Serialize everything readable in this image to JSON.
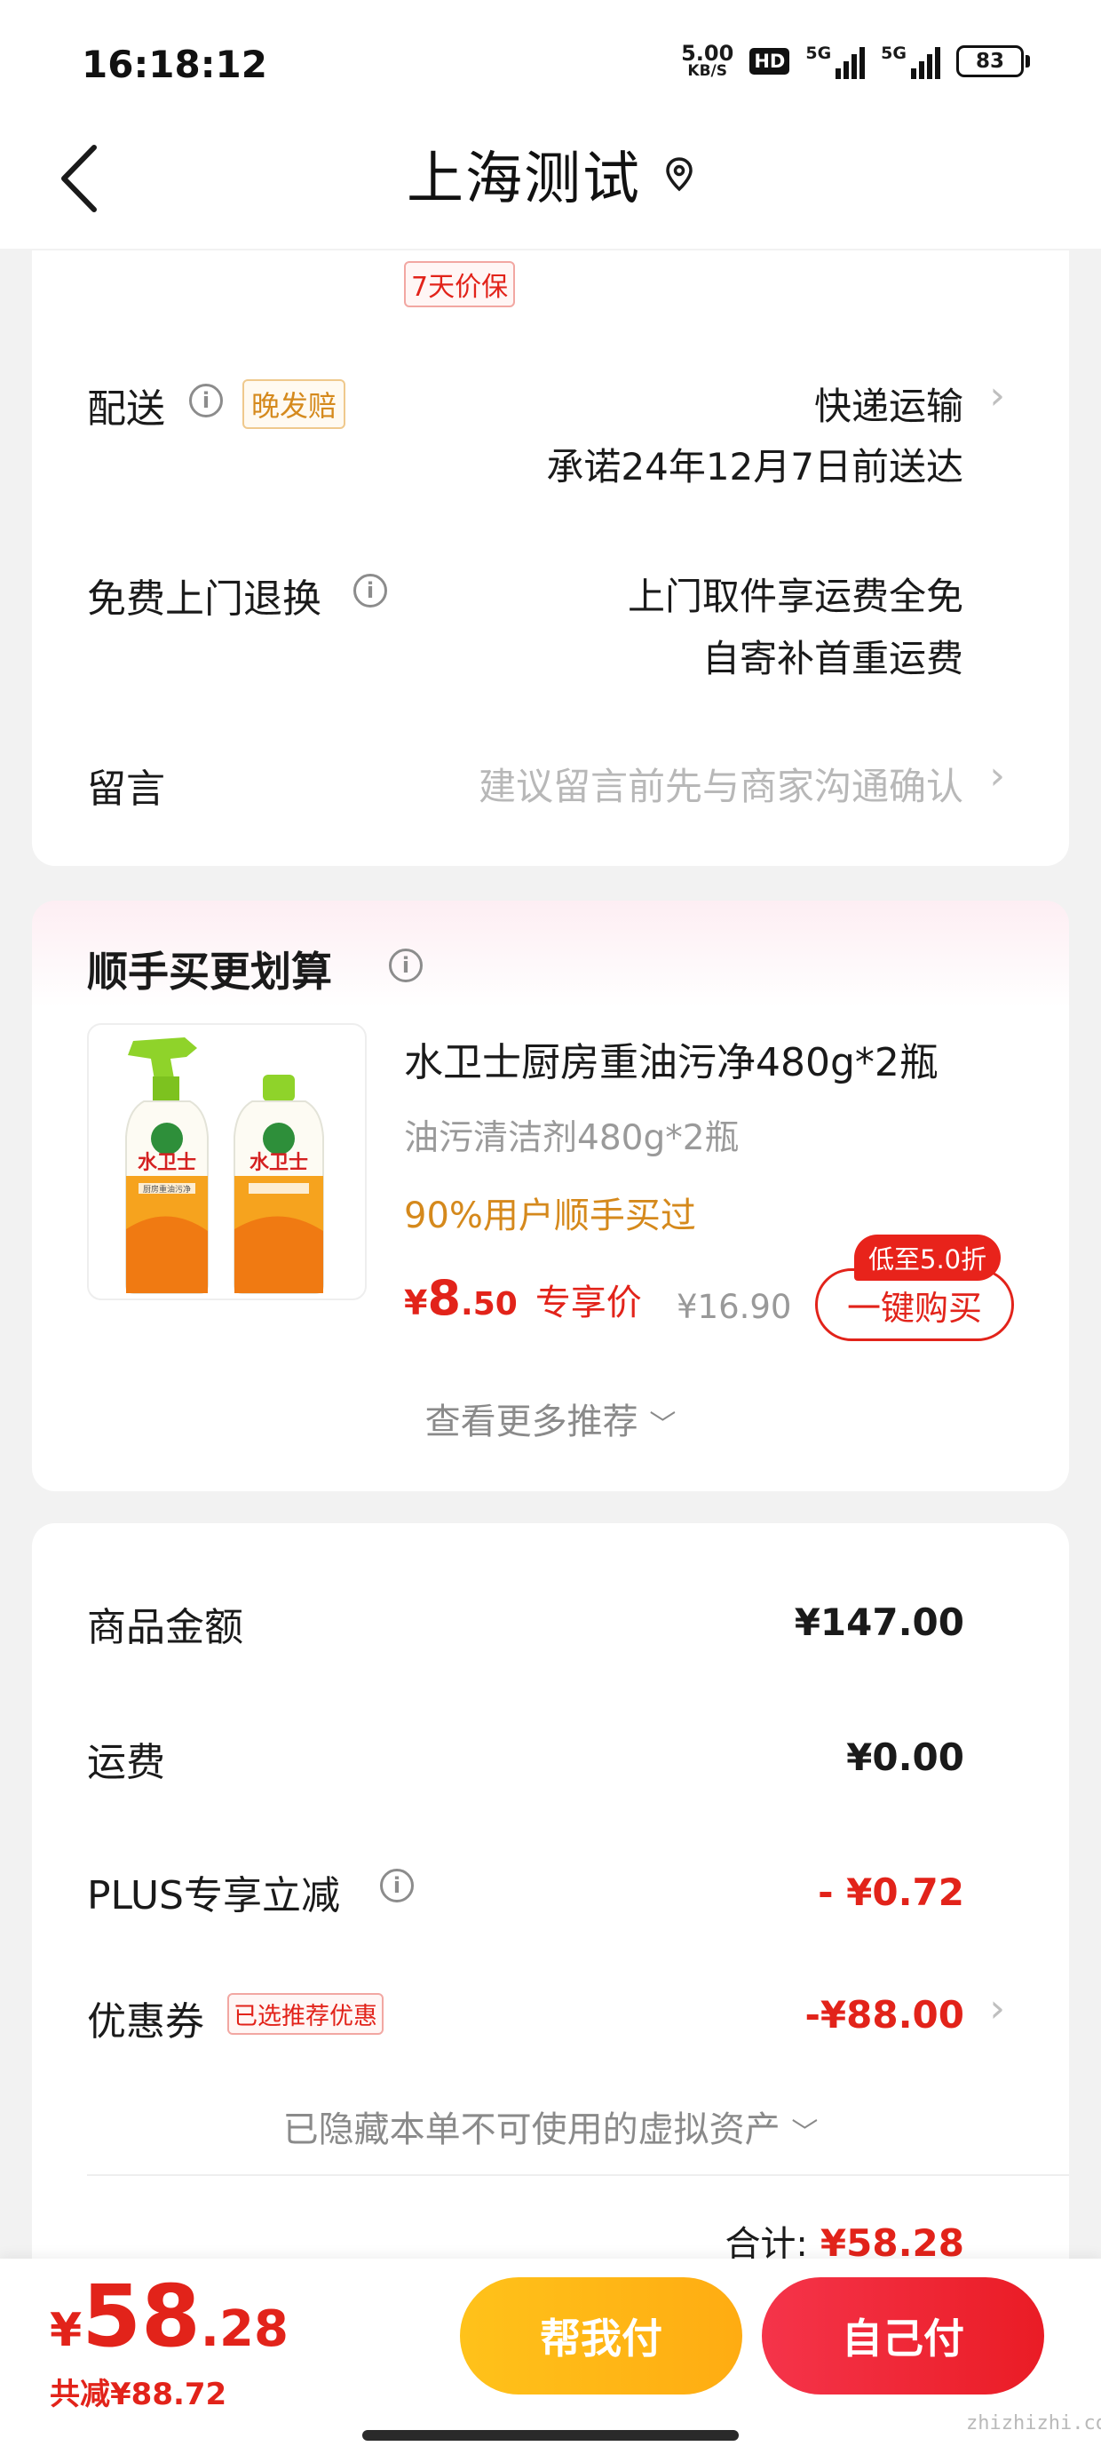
{
  "status_bar": {
    "time": "16:18:12",
    "net_speed_value": "5.00",
    "net_speed_unit": "KB/S",
    "hd_label": "HD",
    "signal1_label": "5G",
    "signal2_label": "5G",
    "battery": "83"
  },
  "nav": {
    "title": "上海测试",
    "back_icon": "chevron-left-icon",
    "location_icon": "location-pin-icon"
  },
  "order_info": {
    "price_protect_tag": "7天价保",
    "delivery": {
      "label": "配送",
      "late_tag": "晚发赔",
      "method": "快递运输",
      "promise": "承诺24年12月7日前送达"
    },
    "return": {
      "label": "免费上门退换",
      "line1": "上门取件享运费全免",
      "line2": "自寄补首重运费"
    },
    "message": {
      "label": "留言",
      "placeholder": "建议留言前先与商家沟通确认"
    }
  },
  "recommend": {
    "title": "顺手买更划算",
    "product": {
      "name": "水卫士厨房重油污净480g*2瓶",
      "spec": "油污清洁剂480g*2瓶",
      "social": "90%用户顺手买过",
      "price_currency": "¥",
      "price_int": "8",
      "price_dec": ".50",
      "price_tag": "专享价",
      "original_price": "¥16.90",
      "buy_label": "一键购买",
      "discount_badge": "低至5.0折",
      "brand_text": "水卫士",
      "image_alt_label": "厨房重油污净"
    },
    "more_label": "查看更多推荐"
  },
  "summary": {
    "items_label": "商品金额",
    "items_value": "¥147.00",
    "shipping_label": "运费",
    "shipping_value": "¥0.00",
    "plus_label": "PLUS专享立减",
    "plus_value": "- ¥0.72",
    "coupon_label": "优惠券",
    "coupon_tag": "已选推荐优惠",
    "coupon_value": "-¥88.00",
    "hidden_assets": "已隐藏本单不可使用的虚拟资产",
    "total_label": "合计:",
    "total_value": "¥58.28"
  },
  "bottom": {
    "currency": "¥",
    "price_int": "58",
    "price_dec": ".28",
    "saved": "共减¥88.72",
    "help_pay": "帮我付",
    "self_pay": "自己付",
    "watermark": "zhizhizhi.com"
  },
  "colors": {
    "accent_red": "#e2231a",
    "accent_orange": "#d5891c",
    "pay_yellow": "#ffb816"
  }
}
